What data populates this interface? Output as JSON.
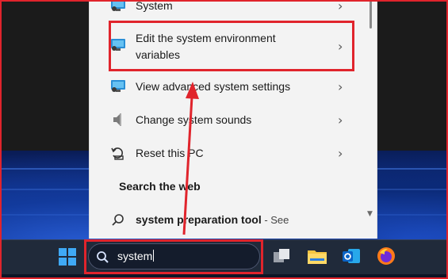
{
  "results": [
    {
      "label": "System",
      "icon": "monitor-settings-icon"
    },
    {
      "label": "Edit the system environment",
      "label2": "variables",
      "icon": "monitor-settings-icon"
    },
    {
      "label": "View advanced system settings",
      "icon": "monitor-settings-icon"
    },
    {
      "label": "Change system sounds",
      "icon": "speaker-icon"
    },
    {
      "label": "Reset this PC",
      "icon": "reset-pc-icon"
    }
  ],
  "search_web": {
    "title": "Search the web",
    "result_bold": "system preparation tool",
    "result_suffix": " - See"
  },
  "taskbar": {
    "search_value": "system",
    "apps": [
      "windows-start-icon",
      "task-view-icon",
      "file-explorer-icon",
      "outlook-icon",
      "firefox-icon"
    ]
  },
  "colors": {
    "highlight": "#e0242c",
    "panel_bg": "#f3f3f3",
    "taskbar_bg": "#202a3a"
  }
}
